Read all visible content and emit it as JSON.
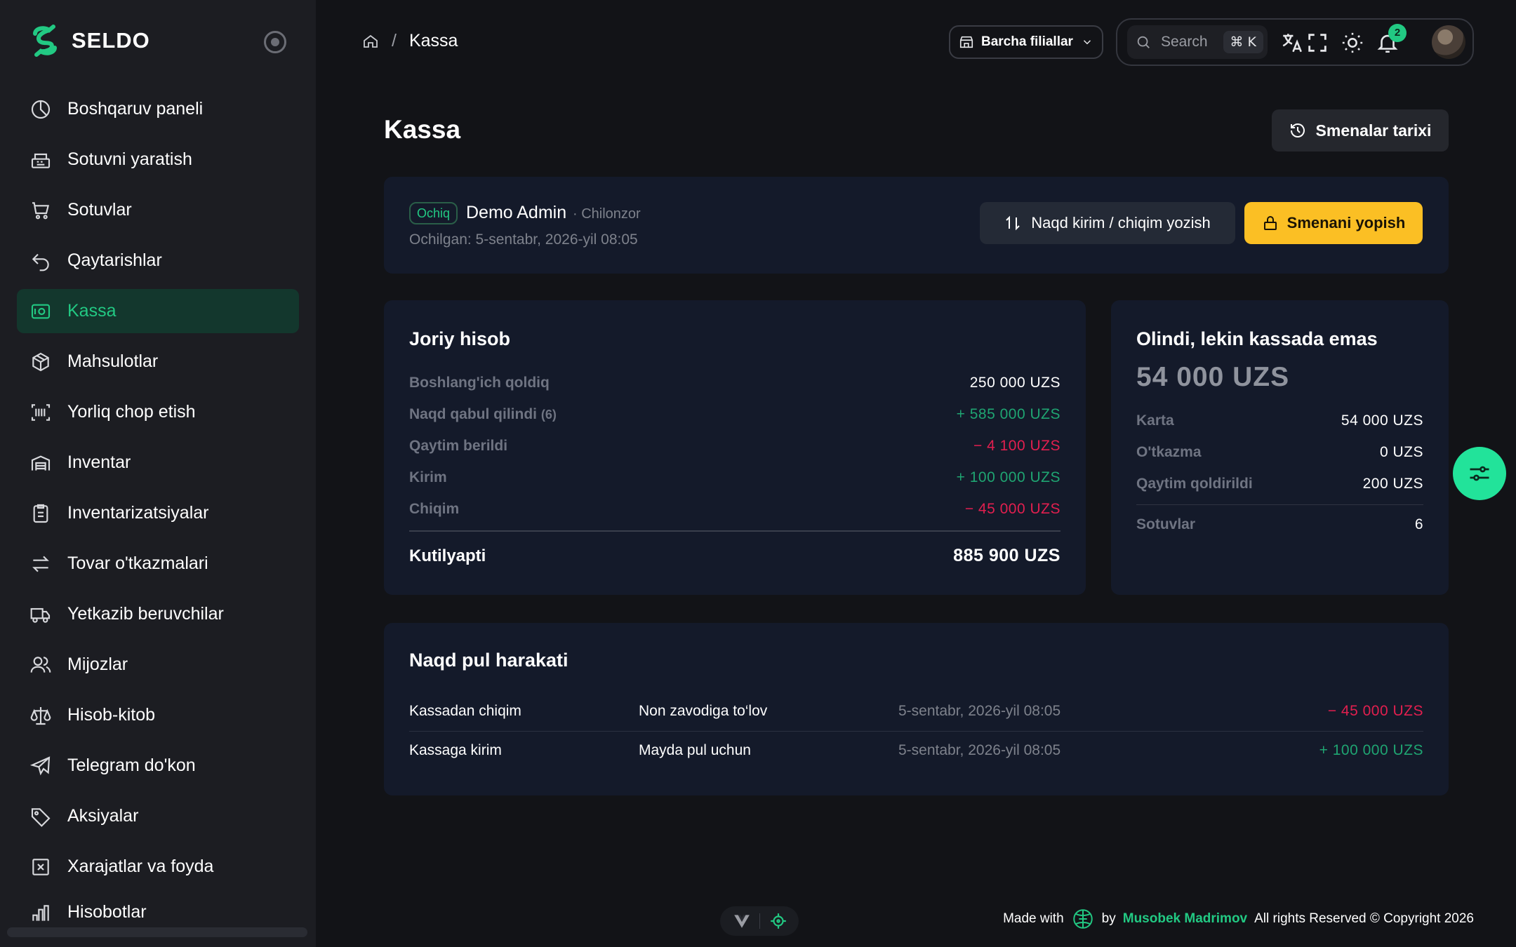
{
  "brand": {
    "name": "SELDO",
    "accent": "#22c983"
  },
  "sidebar": {
    "items": [
      {
        "label": "Boshqaruv paneli",
        "icon": "dashboard-icon"
      },
      {
        "label": "Sotuvni yaratish",
        "icon": "cash-register-icon"
      },
      {
        "label": "Sotuvlar",
        "icon": "cart-icon"
      },
      {
        "label": "Qaytarishlar",
        "icon": "return-icon"
      },
      {
        "label": "Kassa",
        "icon": "safe-icon",
        "active": true
      },
      {
        "label": "Mahsulotlar",
        "icon": "box-icon"
      },
      {
        "label": "Yorliq chop etish",
        "icon": "barcode-icon"
      },
      {
        "label": "Inventar",
        "icon": "warehouse-icon"
      },
      {
        "label": "Inventarizatsiyalar",
        "icon": "clipboard-icon"
      },
      {
        "label": "Tovar o'tkazmalari",
        "icon": "transfer-icon"
      },
      {
        "label": "Yetkazib beruvchilar",
        "icon": "truck-icon"
      },
      {
        "label": "Mijozlar",
        "icon": "users-icon"
      },
      {
        "label": "Hisob-kitob",
        "icon": "scale-icon"
      },
      {
        "label": "Telegram do'kon",
        "icon": "telegram-icon"
      },
      {
        "label": "Aksiyalar",
        "icon": "tag-icon"
      },
      {
        "label": "Xarajatlar va foyda",
        "icon": "expense-icon"
      },
      {
        "label": "Hisobotlar",
        "icon": "report-icon"
      }
    ]
  },
  "header": {
    "breadcrumb": {
      "current": "Kassa"
    },
    "branch_select": "Barcha filiallar",
    "search": {
      "placeholder": "Search",
      "shortcut": "⌘ K"
    },
    "notifications_count": "2"
  },
  "page": {
    "title": "Kassa",
    "history_button": "Smenalar tarixi"
  },
  "shift": {
    "status": "Ochiq",
    "user": "Demo Admin",
    "branch": "· Chilonzor",
    "opened": "Ochilgan: 5-sentabr, 2026-yil 08:05",
    "cash_button": "Naqd kirim / chiqim yozish",
    "close_button": "Smenani yopish"
  },
  "balance": {
    "title": "Joriy hisob",
    "rows": [
      {
        "label": "Boshlang'ich qoldiq",
        "value": "250 000 UZS"
      },
      {
        "label": "Naqd qabul qilindi",
        "count": "(6)",
        "value": "+ 585 000 UZS"
      },
      {
        "label": "Qaytim berildi",
        "value": "− 4 100 UZS"
      },
      {
        "label": "Kirim",
        "value": "+ 100 000 UZS"
      },
      {
        "label": "Chiqim",
        "value": "− 45 000 UZS"
      }
    ],
    "total_label": "Kutilyapti",
    "total_value": "885 900 UZS"
  },
  "received": {
    "title": "Olindi, lekin kassada emas",
    "amount": "54 000 UZS",
    "rows": [
      {
        "label": "Karta",
        "value": "54 000 UZS"
      },
      {
        "label": "O'tkazma",
        "value": "0 UZS"
      },
      {
        "label": "Qaytim qoldirildi",
        "value": "200 UZS"
      }
    ],
    "sales_label": "Sotuvlar",
    "sales_value": "6"
  },
  "movements": {
    "title": "Naqd pul harakati",
    "rows": [
      {
        "type": "Kassadan chiqim",
        "note": "Non zavodiga to‘lov",
        "date": "5-sentabr, 2026-yil 08:05",
        "amount": "− 45 000 UZS"
      },
      {
        "type": "Kassaga kirim",
        "note": "Mayda pul uchun",
        "date": "5-sentabr, 2026-yil 08:05",
        "amount": "+ 100 000 UZS"
      }
    ]
  },
  "footer": {
    "made_with": "Made with",
    "by": "by",
    "author": "Musobek Madrimov",
    "rights": "All rights Reserved © Copyright 2026"
  },
  "colors": {
    "positive": "#1fa572",
    "negative": "#e21f4f",
    "warning": "#fbbf24"
  }
}
